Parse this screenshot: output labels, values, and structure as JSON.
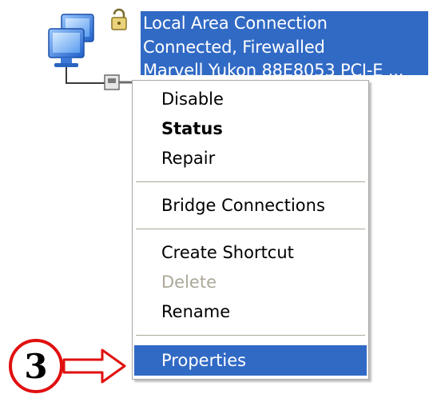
{
  "connection": {
    "name": "Local Area Connection",
    "status": "Connected, Firewalled",
    "device": "Marvell Yukon 88E8053 PCI-E ..."
  },
  "menu": {
    "items": [
      {
        "label": "Disable",
        "style": "normal"
      },
      {
        "label": "Status",
        "style": "bold"
      },
      {
        "label": "Repair",
        "style": "normal"
      },
      {
        "label": "Bridge Connections",
        "style": "normal"
      },
      {
        "label": "Create Shortcut",
        "style": "normal"
      },
      {
        "label": "Delete",
        "style": "disabled"
      },
      {
        "label": "Rename",
        "style": "normal"
      },
      {
        "label": "Properties",
        "style": "selected"
      }
    ]
  },
  "annotation": {
    "step_number": "3"
  },
  "colors": {
    "selection": "#316ac5",
    "disabled_text": "#aca899",
    "annotation_red": "#e01010"
  }
}
